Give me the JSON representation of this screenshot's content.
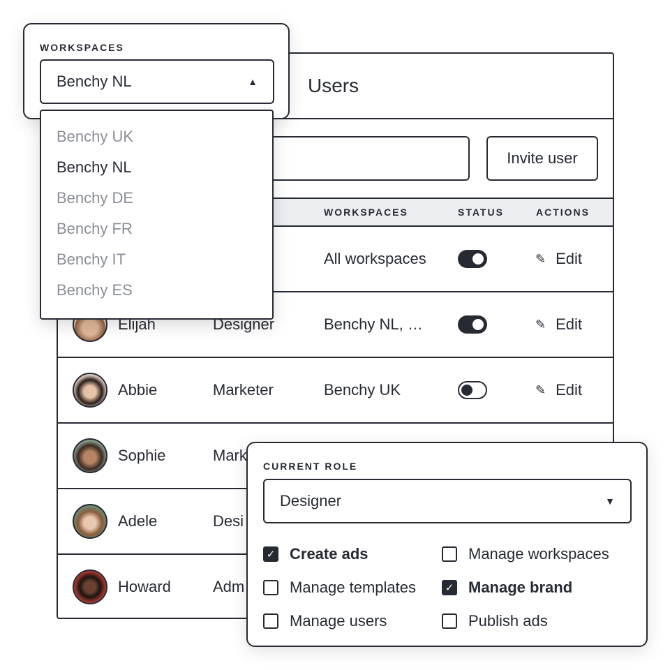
{
  "users": {
    "title": "Users",
    "invite_label": "Invite user",
    "columns": [
      "WORKSPACES",
      "STATUS",
      "ACTIONS"
    ],
    "rows": [
      {
        "name": "",
        "role": "",
        "workspaces": "All workspaces",
        "active": true,
        "action": "Edit"
      },
      {
        "name": "Elijah",
        "role": "Designer",
        "workspaces": "Benchy NL, …",
        "active": true,
        "action": "Edit"
      },
      {
        "name": "Abbie",
        "role": "Marketer",
        "workspaces": "Benchy UK",
        "active": false,
        "action": "Edit"
      },
      {
        "name": "Sophie",
        "role": "Mark",
        "workspaces": "",
        "action": ""
      },
      {
        "name": "Adele",
        "role": "Desi",
        "workspaces": "",
        "action": ""
      },
      {
        "name": "Howard",
        "role": "Adm",
        "workspaces": "",
        "action": ""
      }
    ]
  },
  "workspaces": {
    "label": "WORKSPACES",
    "selected": "Benchy NL",
    "options": [
      "Benchy UK",
      "Benchy NL",
      "Benchy DE",
      "Benchy FR",
      "Benchy IT",
      "Benchy ES"
    ]
  },
  "role": {
    "label": "CURRENT ROLE",
    "selected": "Designer",
    "permissions": [
      {
        "label": "Create ads",
        "checked": true
      },
      {
        "label": "Manage workspaces",
        "checked": false
      },
      {
        "label": "Manage templates",
        "checked": false
      },
      {
        "label": "Manage brand",
        "checked": true
      },
      {
        "label": "Manage users",
        "checked": false
      },
      {
        "label": "Publish ads",
        "checked": false
      }
    ]
  },
  "colors": {
    "ink": "#262a33",
    "header_bg": "#eceef1",
    "muted": "#8a8e96"
  }
}
